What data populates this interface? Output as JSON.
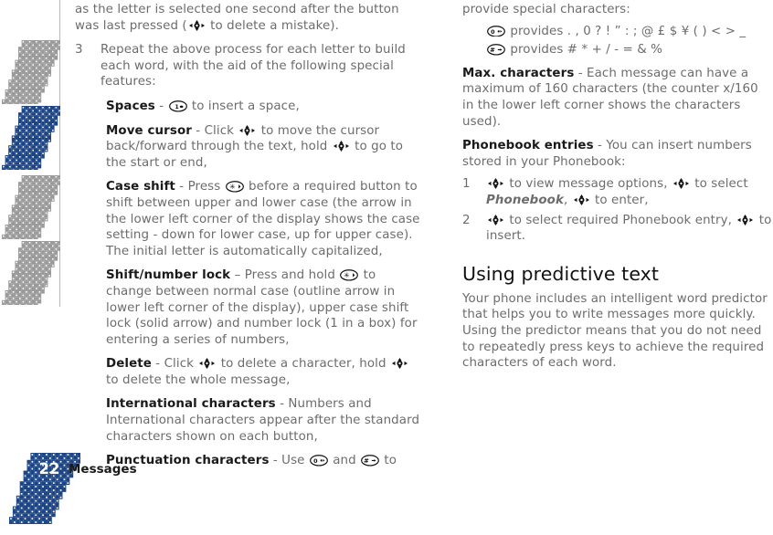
{
  "page": {
    "number": "22",
    "section_label": "Messages",
    "accent_color": "#1d4585",
    "halftone_color": "#9a9a9a",
    "body_text_color": "#6c6c6c",
    "heading_text_color": "#111111"
  },
  "icons": {
    "nav": "joystick-navigation-icon",
    "key_1": "phone-key-1-icon",
    "key_star": "phone-key-star-icon",
    "key_0": "phone-key-0-icon",
    "key_hash": "phone-key-hash-icon"
  },
  "left_column": {
    "continued_paragraph": {
      "line1": "as the letter is selected one second after the button",
      "line2_before": "was last pressed (",
      "line2_after": " to delete a mistake)."
    },
    "numbered_item": {
      "number": "3",
      "text": "Repeat the above process for each letter to build each word, with the aid of the following special features:"
    },
    "definitions": [
      {
        "term": "Spaces",
        "dash": " - ",
        "text_before": "",
        "text_after": " to insert a space,",
        "icon": "key_1"
      },
      {
        "term": "Move cursor",
        "dash": " - ",
        "text_before": "Click ",
        "text_mid": " to move the cursor back/forward through the text, hold ",
        "text_after": " to go to the start or end,",
        "icon": "nav"
      },
      {
        "term": "Case shift",
        "dash": " - ",
        "text_before": "Press ",
        "text_after": " before a required button to shift between upper and lower case (the arrow in the lower left corner of the display shows the case setting - down for lower case, up for upper case). The initial letter is automatically capitalized,",
        "icon": "key_star"
      },
      {
        "term": "Shift/number lock",
        "dash": " – ",
        "text_before": "Press and hold ",
        "text_after": " to change between normal case (outline arrow in lower left corner of the display), upper case shift lock (solid arrow) and number lock (1 in a box) for entering a series of numbers,",
        "icon": "key_star"
      },
      {
        "term": "Delete",
        "dash": " - ",
        "text_before": "Click ",
        "text_mid": " to delete a character, hold ",
        "text_after": " to delete the whole message,",
        "icon": "nav"
      },
      {
        "term": "International characters",
        "dash": " - ",
        "text_before": "Numbers and International characters appear after the standard characters shown on each button,",
        "text_after": "",
        "icon": null
      },
      {
        "term": "Punctuation characters",
        "dash": " - ",
        "text_before": "Use ",
        "text_mid": " and ",
        "text_after": " to",
        "icon": "key_0",
        "icon2": "key_hash"
      }
    ]
  },
  "right_column": {
    "continued_line": "provide special characters:",
    "char_lines": [
      {
        "icon": "key_0",
        "text": "provides . , 0 ? ! ” : ; @ £ $ ¥ ( ) < > _"
      },
      {
        "icon": "key_hash",
        "text": "provides # * + / - = & %"
      }
    ],
    "definitions": [
      {
        "term": "Max. characters",
        "dash": " - ",
        "text": "Each message can have a maximum of 160 characters (the counter x/160 in the lower left corner shows the characters used)."
      },
      {
        "term": "Phonebook entries",
        "dash": " - ",
        "text": "You can insert numbers stored in your Phonebook:"
      }
    ],
    "steps": [
      {
        "number": "1",
        "part1": " to view message options, ",
        "part2": " to select ",
        "italic": "Phonebook",
        "part3": ", ",
        "part4": " to enter,",
        "icon": "nav"
      },
      {
        "number": "2",
        "part1": " to select required Phonebook entry, ",
        "part2": " to insert.",
        "icon": "nav"
      }
    ],
    "section_heading": "Using predictive text",
    "section_body": "Your phone includes an intelligent word predictor that helps you to write messages more quickly. Using the predictor means that you do not need to repeatedly press keys to achieve the required characters of each word."
  }
}
